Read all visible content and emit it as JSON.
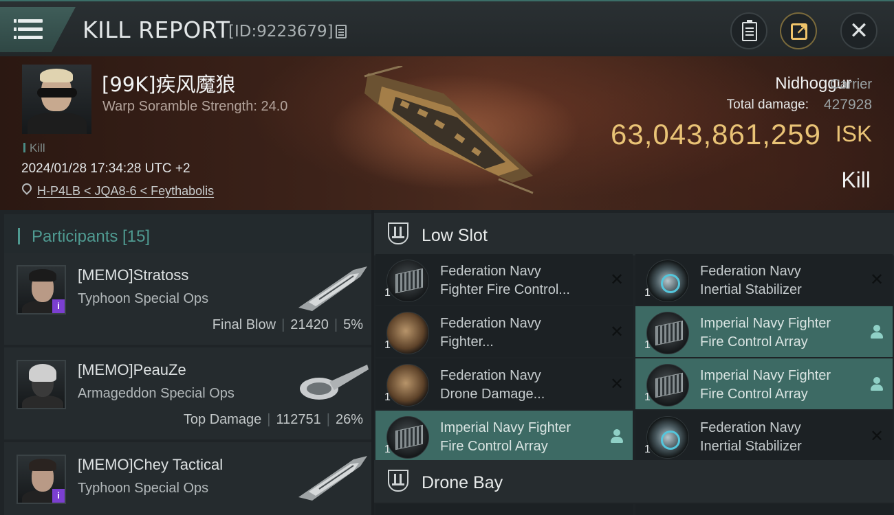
{
  "header": {
    "title": "KILL REPORT",
    "report_id": "[ID:9223679]",
    "icons": {
      "menu": "hamburger-menu-icon",
      "copy": "copy-icon",
      "clipboard": "clipboard-icon",
      "share": "share-icon",
      "close": "close-icon"
    }
  },
  "victim": {
    "name": "[99K]疾风魔狼",
    "scramble": "Warp Soramble Strength: 24.0",
    "tag": "Kill",
    "datetime": "2024/01/28 17:34:28 UTC +2",
    "location": "H-P4LB < JQA8-6 < Feythabolis"
  },
  "ship": {
    "name": "Nidhoggur",
    "class": "Carrier",
    "damage_label": "Total damage:",
    "damage_value": "427928",
    "isk_value": "63,043,861,259",
    "isk_unit": "ISK",
    "outcome": "Kill"
  },
  "participants": {
    "label": "Participants [15]",
    "items": [
      {
        "name": "[MEMO]Stratoss",
        "ship": "Typhoon Special Ops",
        "role": "Final Blow",
        "damage": "21420",
        "percent": "5%"
      },
      {
        "name": "[MEMO]PeauZe",
        "ship": "Armageddon Special Ops",
        "role": "Top Damage",
        "damage": "112751",
        "percent": "26%"
      },
      {
        "name": "[MEMO]Chey Tactical",
        "ship": "Typhoon Special Ops"
      }
    ]
  },
  "modules": {
    "low_slot_label": "Low Slot",
    "drone_bay_label": "Drone Bay",
    "items": [
      {
        "name": "Federation Navy\nFighter Fire Control...",
        "qty": "1",
        "icon": "fire-control-array-icon",
        "state": "destroyed",
        "state_glyph": "✕"
      },
      {
        "name": "Federation Navy\nInertial Stabilizer",
        "qty": "1",
        "icon": "inertial-stabilizer-icon",
        "state": "destroyed",
        "state_glyph": "✕"
      },
      {
        "name": "Federation Navy\nFighter...",
        "qty": "1",
        "icon": "fighter-dish-icon",
        "state": "destroyed",
        "state_glyph": "✕"
      },
      {
        "name": "Imperial Navy Fighter\nFire Control Array",
        "qty": "1",
        "icon": "fire-control-array-icon",
        "state": "dropped"
      },
      {
        "name": "Federation Navy\nDrone Damage...",
        "qty": "1",
        "icon": "drone-damage-dish-icon",
        "state": "destroyed",
        "state_glyph": "✕"
      },
      {
        "name": "Imperial Navy Fighter\nFire Control Array",
        "qty": "1",
        "icon": "fire-control-array-icon",
        "state": "dropped"
      },
      {
        "name": "Imperial Navy Fighter\nFire Control Array",
        "qty": "1",
        "icon": "fire-control-array-icon",
        "state": "dropped"
      },
      {
        "name": "Federation Navy\nInertial Stabilizer",
        "qty": "1",
        "icon": "inertial-stabilizer-icon",
        "state": "destroyed",
        "state_glyph": "✕"
      }
    ]
  },
  "colors": {
    "accent": "#4f9a91",
    "isk": "#e9c376",
    "fitted_bg": "#3d6a64"
  }
}
